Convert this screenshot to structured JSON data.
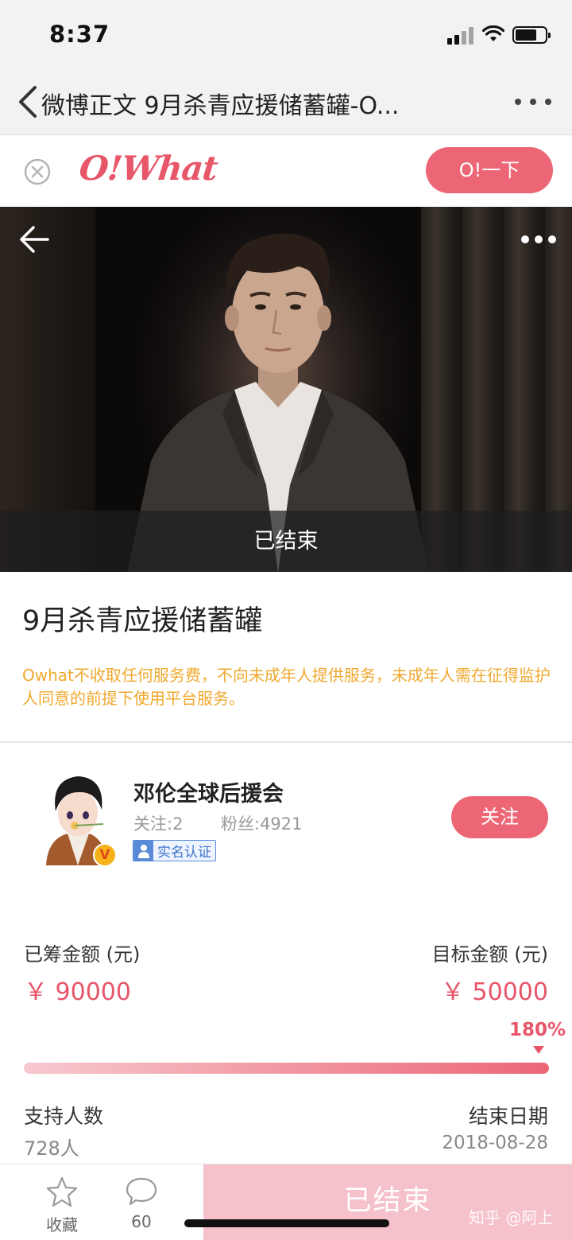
{
  "status_bar": {
    "time": "8:37"
  },
  "nav": {
    "title": "微博正文 9月杀青应援储蓄罐-O..."
  },
  "owhat": {
    "logo": "O!What",
    "action_label": "O!一下"
  },
  "hero": {
    "status": "已结束"
  },
  "project": {
    "title": "9月杀青应援储蓄罐",
    "notice": "Owhat不收取任何服务费，不向未成年人提供服务，未成年人需在征得监护人同意的前提下使用平台服务。"
  },
  "organizer": {
    "name": "邓伦全球后援会",
    "follow_count": "关注:2",
    "fans_count": "粉丝:4921",
    "verify_label": "实名认证",
    "v_badge": "V",
    "follow_button": "关注"
  },
  "funding": {
    "raised_label": "已筹金额 (元)",
    "raised_value": "￥ 90000",
    "target_label": "目标金额 (元)",
    "target_value": "￥ 50000",
    "percent_label": "180%",
    "progress_fraction": 1.0,
    "backers_label": "支持人数",
    "backers_value": "728人",
    "end_date_label": "结束日期",
    "end_date_value": "2018-08-28"
  },
  "bottom_bar": {
    "favorite_label": "收藏",
    "comment_count": "60",
    "ended_button": "已结束"
  },
  "watermark": "知乎 @阿上",
  "colors": {
    "accent": "#ec6676",
    "price": "#e8566a",
    "notice": "#f0a92e",
    "ended_button": "#f5c1cb",
    "verify": "#5a8bd8"
  },
  "icons": {
    "nav_back": "chevron-left-icon",
    "nav_more": "more-dots-icon",
    "close": "close-circle-icon",
    "hero_back": "arrow-left-icon",
    "hero_more": "more-dots-icon",
    "favorite": "star-icon",
    "comment": "speech-bubble-icon",
    "verify": "person-icon",
    "wifi": "wifi-icon",
    "signal": "signal-icon",
    "battery": "battery-icon"
  }
}
